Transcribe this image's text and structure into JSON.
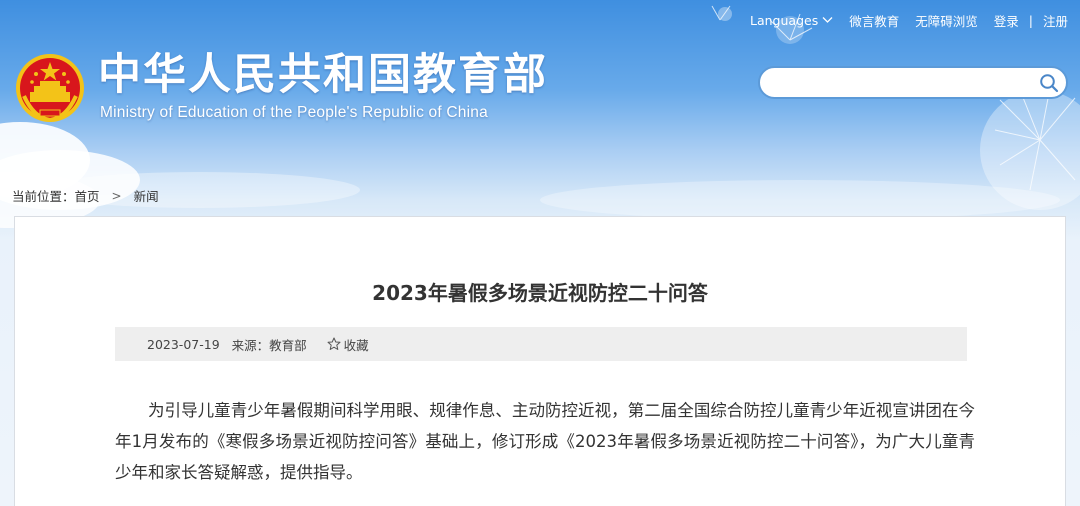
{
  "header": {
    "site_title": "中华人民共和国教育部",
    "site_subtitle": "Ministry of Education of the People's Republic of China",
    "emblem_icon": "national-emblem-icon"
  },
  "topnav": {
    "languages": "Languages",
    "weiyan": "微言教育",
    "accessibility": "无障碍浏览",
    "login": "登录",
    "separator": "|",
    "register": "注册"
  },
  "search": {
    "value": "",
    "placeholder": "",
    "icon": "search-icon"
  },
  "breadcrumb": {
    "prefix": "当前位置：",
    "home": "首页",
    "arrow": ">",
    "current": "新闻"
  },
  "article": {
    "title": "2023年暑假多场景近视防控二十问答",
    "date": "2023-07-19",
    "source": "来源：教育部",
    "favorite": "收藏",
    "favorite_icon": "star-icon",
    "paragraph": "为引导儿童青少年暑假期间科学用眼、规律作息、主动防控近视，第二届全国综合防控儿童青少年近视宣讲团在今年1月发布的《寒假多场景近视防控问答》基础上，修订形成《2023年暑假多场景近视防控二十问答》，为广大儿童青少年和家长答疑解惑，提供指导。"
  },
  "colors": {
    "sky_top": "#3f8fe0",
    "sky_bottom": "#eef4fb",
    "emblem_red": "#d8161c",
    "emblem_gold": "#f3c318",
    "search_border": "#5c9ad8",
    "text": "#333333",
    "meta_bg": "#eeeeee"
  }
}
